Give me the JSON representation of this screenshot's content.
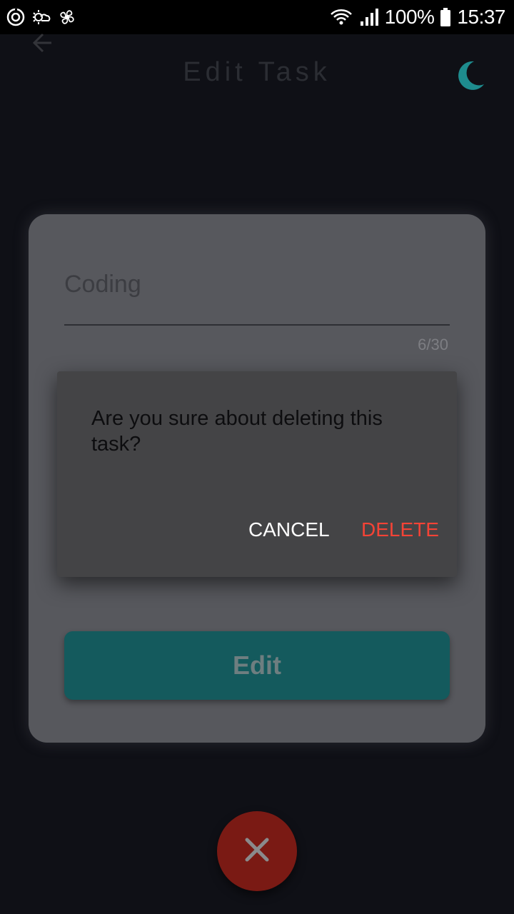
{
  "status_bar": {
    "left_icons": [
      "sync-icon",
      "weather-icon",
      "fan-icon"
    ],
    "battery": "100%",
    "time": "15:37"
  },
  "app_bar": {
    "title": "Edit Task",
    "back_icon": "back-arrow-icon",
    "theme_icon": "moon-icon"
  },
  "form": {
    "task_value": "Coding",
    "char_counter": "6/30",
    "edit_button_label": "Edit"
  },
  "dialog": {
    "message": "Are you sure about deleting this task?",
    "cancel_label": "CANCEL",
    "delete_label": "DELETE"
  },
  "fab": {
    "icon": "close-icon"
  },
  "colors": {
    "background": "#0f1016",
    "card": "#57585d",
    "dialog": "#444446",
    "accent": "#145a5d",
    "delete": "#f44336",
    "fab": "#7a1a14",
    "moon": "#1e8c8e"
  }
}
